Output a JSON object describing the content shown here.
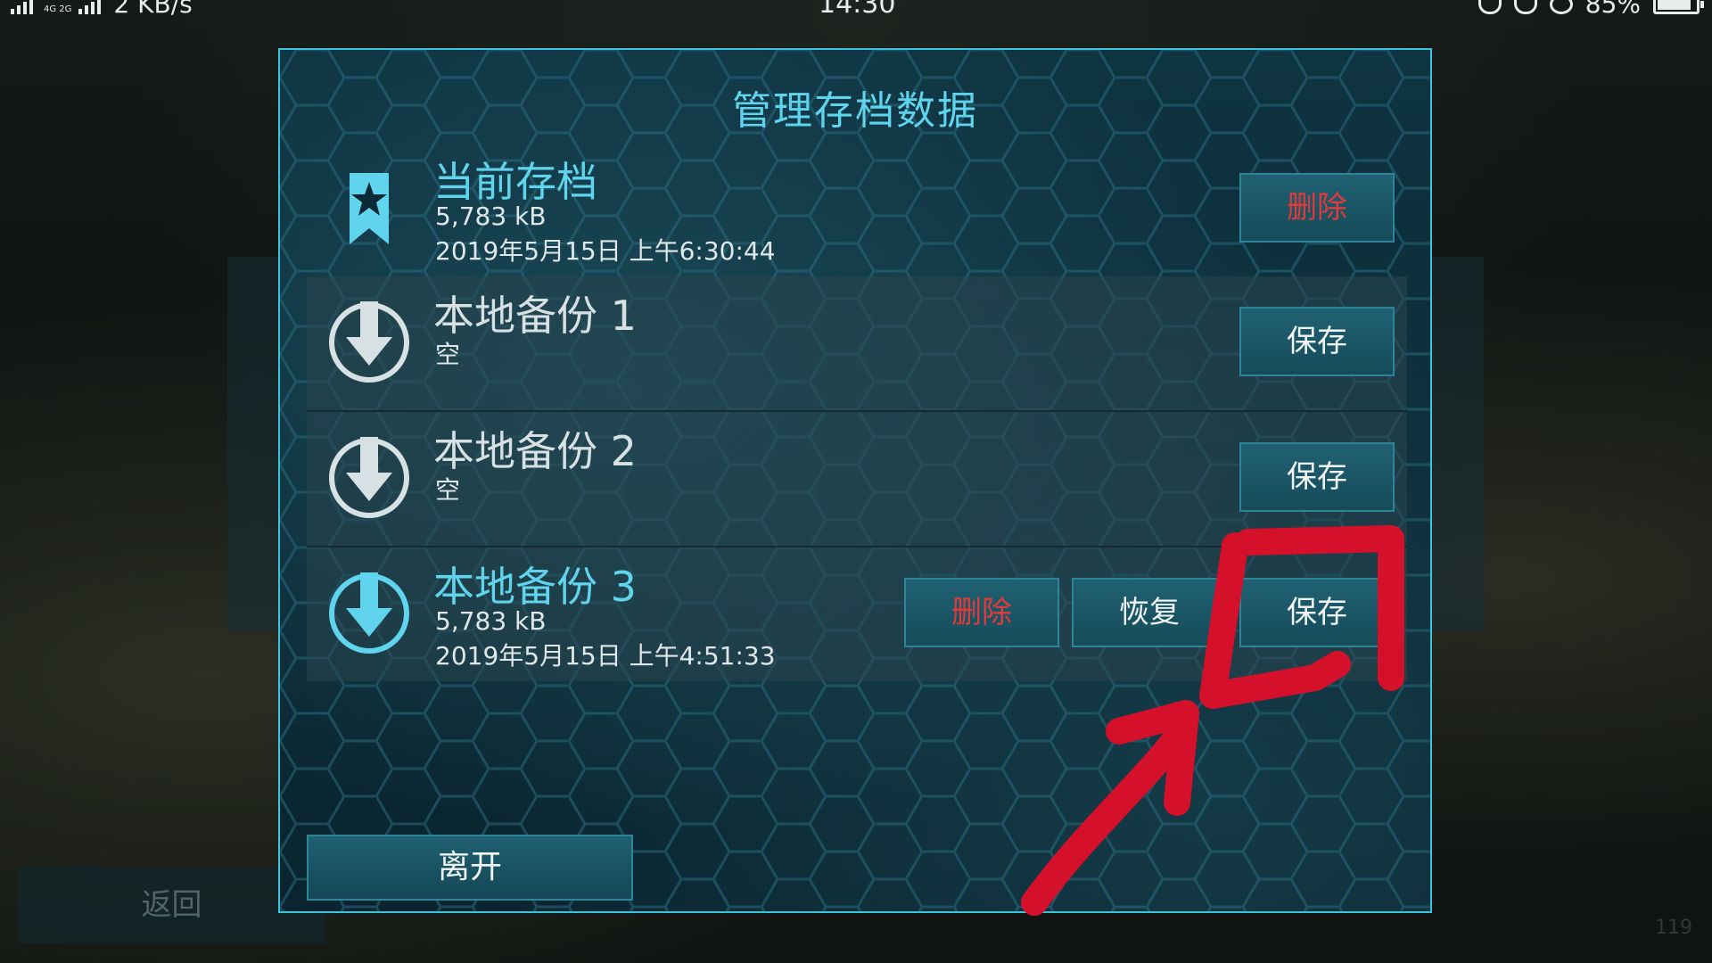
{
  "status_bar": {
    "net_type": "4G 2G",
    "speed": "2 KB/s",
    "time": "14:30",
    "battery": "85%"
  },
  "background": {
    "back_label": "返回",
    "page_number": "119"
  },
  "dialog": {
    "title": "管理存档数据",
    "current_save": {
      "title": "当前存档",
      "size": "5,783 kB",
      "date": "2019年5月15日 上午6:30:44",
      "delete_label": "删除"
    },
    "slots": [
      {
        "title": "本地备份 1",
        "status": "空",
        "save_label": "保存"
      },
      {
        "title": "本地备份 2",
        "status": "空",
        "save_label": "保存"
      },
      {
        "title": "本地备份 3",
        "size": "5,783 kB",
        "date": "2019年5月15日 上午4:51:33",
        "delete_label": "删除",
        "restore_label": "恢复",
        "save_label": "保存"
      }
    ],
    "leave_label": "离开"
  },
  "colors": {
    "accent": "#5fd4ec",
    "delete_text": "#e23a3a",
    "annotation": "#d4102a"
  },
  "icons": {
    "current_save": "bookmark-star-icon",
    "slot": "download-arrow-icon"
  }
}
